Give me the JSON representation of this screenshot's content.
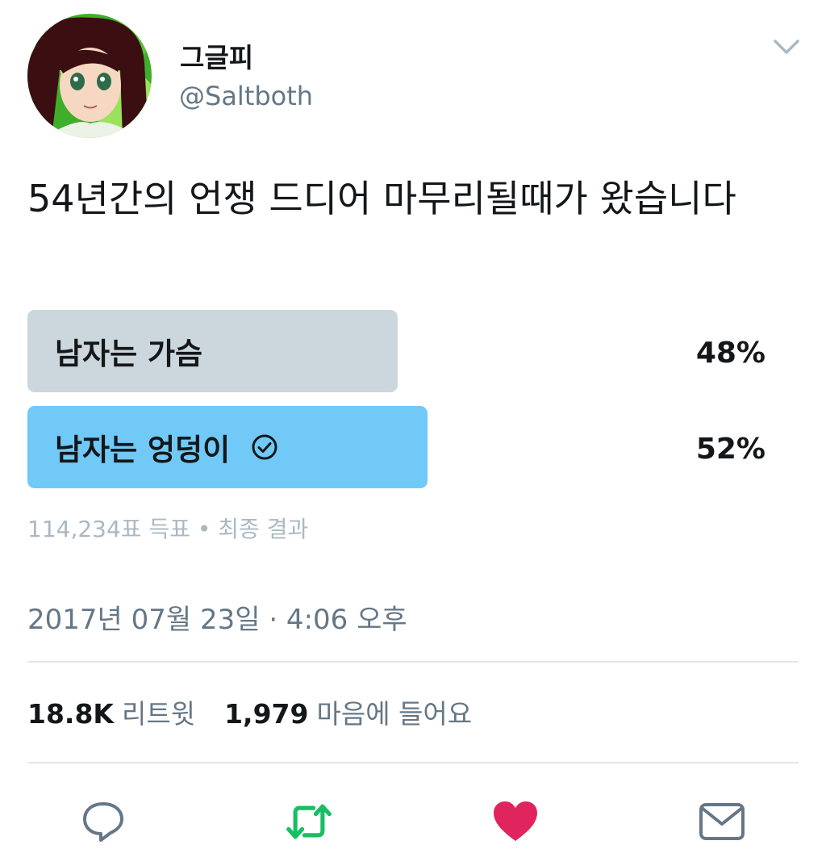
{
  "user": {
    "display_name": "그글피",
    "handle": "@Saltboth"
  },
  "tweet": {
    "text": "54년간의 언쟁 드디어 마무리될때가 왔습니다"
  },
  "poll": {
    "options": [
      {
        "label": "남자는 가슴",
        "percent": "48%",
        "selected": false
      },
      {
        "label": "남자는 엉덩이",
        "percent": "52%",
        "selected": true
      }
    ],
    "meta": "114,234표 득표 • 최종 결과"
  },
  "timestamp": "2017년 07월 23일 · 4:06 오후",
  "stats": {
    "retweets_count": "18.8K",
    "retweets_label": "리트윗",
    "likes_count": "1,979",
    "likes_label": "마음에 들어요"
  },
  "icons": {
    "reply": "reply-icon",
    "retweet": "retweet-icon",
    "like": "heart-icon",
    "dm": "mail-icon",
    "menu": "chevron-down-icon",
    "winner": "check-circle-icon"
  },
  "colors": {
    "winner_bar": "#71c9f8",
    "loser_bar": "#ccd6dd",
    "retweet": "#17bf63",
    "like": "#e0245e",
    "muted": "#657786"
  }
}
